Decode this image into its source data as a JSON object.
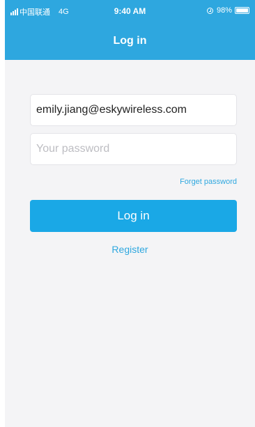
{
  "status_bar": {
    "carrier": "中国联通",
    "network": "4G",
    "time": "9:40 AM",
    "battery": "98%",
    "battery_level": 0.98
  },
  "header": {
    "title": "Log in"
  },
  "form": {
    "email_value": "emily.jiang@eskywireless.com",
    "password_value": "",
    "password_placeholder": "Your password",
    "forgot_label": "Forget password",
    "login_label": "Log in",
    "register_label": "Register"
  },
  "colors": {
    "header_bg": "#2ea7df",
    "button_bg": "#1aa8e6",
    "link": "#2ea7df",
    "screen_bg": "#f4f4f6"
  },
  "icons": [
    "signal-icon",
    "orientation-lock-icon",
    "battery-icon"
  ]
}
